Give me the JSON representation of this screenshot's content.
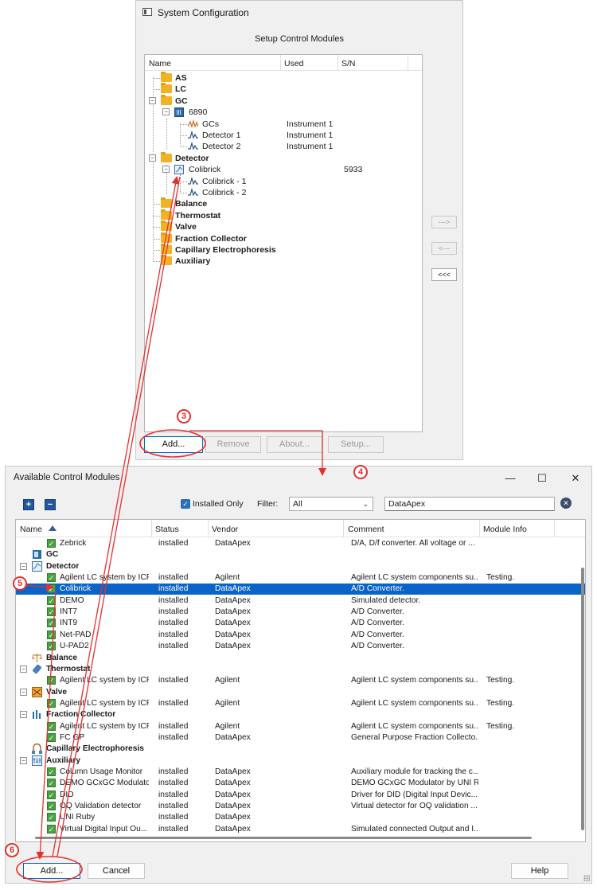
{
  "system_config": {
    "title": "System Configuration",
    "subtitle": "Setup Control Modules",
    "columns": [
      "Name",
      "Used",
      "S/N"
    ],
    "tree": [
      {
        "label": "AS",
        "bold": true,
        "type": "folder",
        "level": 0
      },
      {
        "label": "LC",
        "bold": true,
        "type": "folder",
        "level": 0
      },
      {
        "label": "GC",
        "bold": true,
        "type": "folder",
        "level": 0,
        "expander": "−"
      },
      {
        "label": "6890",
        "type": "gc",
        "level": 1,
        "expander": "−"
      },
      {
        "label": "GCs",
        "type": "wave-orange",
        "level": 2,
        "used": "Instrument 1"
      },
      {
        "label": "Detector 1",
        "type": "wave",
        "level": 2,
        "used": "Instrument 1"
      },
      {
        "label": "Detector 2",
        "type": "wave",
        "level": 2,
        "used": "Instrument 1"
      },
      {
        "label": "Detector",
        "bold": true,
        "type": "folder",
        "level": 0,
        "expander": "−"
      },
      {
        "label": "Colibrick",
        "type": "det",
        "level": 1,
        "expander": "−",
        "sn": "5933"
      },
      {
        "label": "Colibrick - 1",
        "type": "wave",
        "level": 2
      },
      {
        "label": "Colibrick - 2",
        "type": "wave",
        "level": 2
      },
      {
        "label": "Balance",
        "bold": true,
        "type": "folder",
        "level": 0
      },
      {
        "label": "Thermostat",
        "bold": true,
        "type": "folder",
        "level": 0
      },
      {
        "label": "Valve",
        "bold": true,
        "type": "folder",
        "level": 0
      },
      {
        "label": "Fraction Collector",
        "bold": true,
        "type": "folder",
        "level": 0
      },
      {
        "label": "Capillary Electrophoresis",
        "bold": true,
        "type": "folder",
        "level": 0
      },
      {
        "label": "Auxiliary",
        "bold": true,
        "type": "folder",
        "level": 0
      }
    ],
    "arrow_buttons": [
      "--->",
      "<---",
      "<<<"
    ],
    "buttons": {
      "add": "Add...",
      "remove": "Remove",
      "about": "About...",
      "setup": "Setup..."
    }
  },
  "available_modules": {
    "title": "Available Control Modules",
    "window_controls": {
      "minimize": "—",
      "maximize": "☐",
      "close": "✕"
    },
    "toolbar": {
      "expand_all": "+",
      "collapse_all": "−",
      "installed_only_label": "Installed Only",
      "installed_only_checked": true,
      "filter_label": "Filter:",
      "filter_value": "All",
      "search_value": "DataApex"
    },
    "columns": [
      "Name",
      "Status",
      "Vendor",
      "Comment",
      "Module Info"
    ],
    "rows": [
      {
        "kind": "item",
        "name": "Zebrick",
        "status": "installed",
        "vendor": "DataApex",
        "comment": "D/A, D/f converter. All voltage or ...",
        "info": ""
      },
      {
        "kind": "category",
        "name": "GC",
        "icon": "gc-icon"
      },
      {
        "kind": "category",
        "name": "Detector",
        "icon": "detector-icon",
        "expander": "−"
      },
      {
        "kind": "item",
        "name": "Agilent LC system by ICF",
        "status": "installed",
        "vendor": "Agilent",
        "comment": "Agilent LC system components su...",
        "info": "Testing."
      },
      {
        "kind": "item",
        "name": "Colibrick",
        "status": "installed",
        "vendor": "DataApex",
        "comment": "A/D Converter.",
        "info": "",
        "selected": true
      },
      {
        "kind": "item",
        "name": "DEMO",
        "status": "installed",
        "vendor": "DataApex",
        "comment": "Simulated detector.",
        "info": ""
      },
      {
        "kind": "item",
        "name": "INT7",
        "status": "installed",
        "vendor": "DataApex",
        "comment": "A/D Converter.",
        "info": ""
      },
      {
        "kind": "item",
        "name": "INT9",
        "status": "installed",
        "vendor": "DataApex",
        "comment": "A/D Converter.",
        "info": ""
      },
      {
        "kind": "item",
        "name": "Net-PAD",
        "status": "installed",
        "vendor": "DataApex",
        "comment": "A/D Converter.",
        "info": ""
      },
      {
        "kind": "item",
        "name": "U-PAD2",
        "status": "installed",
        "vendor": "DataApex",
        "comment": "A/D Converter.",
        "info": ""
      },
      {
        "kind": "category",
        "name": "Balance",
        "icon": "balance-icon"
      },
      {
        "kind": "category",
        "name": "Thermostat",
        "icon": "thermostat-icon",
        "expander": "−"
      },
      {
        "kind": "item",
        "name": "Agilent LC system by ICF",
        "status": "installed",
        "vendor": "Agilent",
        "comment": "Agilent LC system components su...",
        "info": "Testing."
      },
      {
        "kind": "category",
        "name": "Valve",
        "icon": "valve-icon",
        "expander": "−"
      },
      {
        "kind": "item",
        "name": "Agilent LC system by ICF",
        "status": "installed",
        "vendor": "Agilent",
        "comment": "Agilent LC system components su...",
        "info": "Testing."
      },
      {
        "kind": "category",
        "name": "Fraction Collector",
        "icon": "fraction-collector-icon",
        "expander": "−"
      },
      {
        "kind": "item",
        "name": "Agilent LC system by ICF",
        "status": "installed",
        "vendor": "Agilent",
        "comment": "Agilent LC system components su...",
        "info": "Testing."
      },
      {
        "kind": "item",
        "name": "FC GP",
        "status": "installed",
        "vendor": "DataApex",
        "comment": "General Purpose Fraction Collecto...",
        "info": ""
      },
      {
        "kind": "category",
        "name": "Capillary Electrophoresis",
        "icon": "capillary-icon"
      },
      {
        "kind": "category",
        "name": "Auxiliary",
        "icon": "auxiliary-icon",
        "expander": "−"
      },
      {
        "kind": "item",
        "name": "Column Usage Monitor",
        "status": "installed",
        "vendor": "DataApex",
        "comment": "Auxiliary module for tracking the c...",
        "info": ""
      },
      {
        "kind": "item",
        "name": "DEMO GCxGC Modulator",
        "status": "installed",
        "vendor": "DataApex",
        "comment": "DEMO GCxGC Modulator by UNI R...",
        "info": ""
      },
      {
        "kind": "item",
        "name": "DID",
        "status": "installed",
        "vendor": "DataApex",
        "comment": "Driver for DID (Digital Input Devic...",
        "info": ""
      },
      {
        "kind": "item",
        "name": "OQ Validation detector",
        "status": "installed",
        "vendor": "DataApex",
        "comment": "Virtual detector for OQ validation ...",
        "info": ""
      },
      {
        "kind": "item",
        "name": "UNI Ruby",
        "status": "installed",
        "vendor": "DataApex",
        "comment": "",
        "info": ""
      },
      {
        "kind": "item",
        "name": "Virtual Digital Input Ou...",
        "status": "installed",
        "vendor": "DataApex",
        "comment": "Simulated connected Output and I...",
        "info": ""
      }
    ],
    "buttons": {
      "add": "Add...",
      "cancel": "Cancel",
      "help": "Help"
    }
  },
  "annotations": {
    "step3": "3",
    "step4": "4",
    "step5": "5",
    "step6": "6",
    "color": "#e53030"
  }
}
